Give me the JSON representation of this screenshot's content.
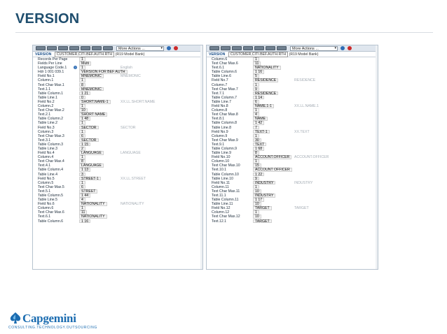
{
  "slide": {
    "title": "VERSION"
  },
  "toolbar": {
    "more_actions": "More Actions ..."
  },
  "left": {
    "app": "VERSION",
    "record_id": "CUSTOMER,CITI.BEF.AUTH.RTH",
    "model": "(R19 Model Bank)",
    "rows": [
      {
        "label": "Records Per Page",
        "value": "1",
        "hint": ""
      },
      {
        "label": "Fields Per Line",
        "value": "Multi",
        "hint": ""
      },
      {
        "label": "Language Code.1",
        "value": "1",
        "hint": "English",
        "help": true
      },
      {
        "label": "Hdr 1 001 039.1",
        "value": "VERSION FOR BEF AUTH",
        "hint": ""
      },
      {
        "label": "Field No.1",
        "value": "MNEMONIC",
        "hint": "MNEMONIC"
      },
      {
        "label": "Column.1",
        "value": "1",
        "hint": ""
      },
      {
        "label": "Text Char Max.1",
        "value": "8",
        "hint": ""
      },
      {
        "label": "Text.1.1",
        "value": "MNEMONIC",
        "hint": ""
      },
      {
        "label": "Table Column.1",
        "value": "1 21",
        "hint": ""
      },
      {
        "label": "Table Line.1",
        "value": "0",
        "hint": ""
      },
      {
        "label": "Field No.2",
        "value": "SHORT.NAME-1",
        "hint": "XX.LL.SHORT.NAME"
      },
      {
        "label": "Column.2",
        "value": "1",
        "hint": ""
      },
      {
        "label": "Text Char Max.2",
        "value": "10",
        "hint": ""
      },
      {
        "label": "Text.2.1",
        "value": "SHORT NAME",
        "hint": ""
      },
      {
        "label": "Table Column.2",
        "value": "1 48",
        "hint": ""
      },
      {
        "label": "Table Line.2",
        "value": "1",
        "hint": ""
      },
      {
        "label": "Field No.3",
        "value": "SECTOR",
        "hint": "SECTOR"
      },
      {
        "label": "Column.3",
        "value": "1",
        "hint": ""
      },
      {
        "label": "Text Char Max.3",
        "value": "6",
        "hint": ""
      },
      {
        "label": "Text.3.1",
        "value": "SECTOR",
        "hint": ""
      },
      {
        "label": "Table Column.3",
        "value": "1 15",
        "hint": ""
      },
      {
        "label": "Table Line.3",
        "value": "2",
        "hint": ""
      },
      {
        "label": "Field No.4",
        "value": "LANGUAGE",
        "hint": "LANGUAGE"
      },
      {
        "label": "Column.4",
        "value": "1",
        "hint": ""
      },
      {
        "label": "Text Char Max.4",
        "value": "8",
        "hint": ""
      },
      {
        "label": "Text.4.1",
        "value": "LANGUAGE",
        "hint": ""
      },
      {
        "label": "Table Column.4",
        "value": "1 13",
        "hint": ""
      },
      {
        "label": "Table Line.4",
        "value": "3",
        "hint": ""
      },
      {
        "label": "Field No.5",
        "value": "STREET-1",
        "hint": "XX.LL.STREET"
      },
      {
        "label": "Column.5",
        "value": "1",
        "hint": ""
      },
      {
        "label": "Text Char Max.5",
        "value": "6",
        "hint": ""
      },
      {
        "label": "Text.5.1",
        "value": "STREET",
        "hint": ""
      },
      {
        "label": "Table Column.5",
        "value": "1 44",
        "hint": ""
      },
      {
        "label": "Table Line.5",
        "value": "4",
        "hint": ""
      },
      {
        "label": "Field No.6",
        "value": "NATIONALITY",
        "hint": "NATIONALITY"
      },
      {
        "label": "Column.6",
        "value": "1",
        "hint": ""
      },
      {
        "label": "Text Char Max.6",
        "value": "11",
        "hint": ""
      },
      {
        "label": "Text.6.1",
        "value": "NATIONALITY",
        "hint": ""
      },
      {
        "label": "Table Column.6",
        "value": "1 16",
        "hint": ""
      }
    ]
  },
  "right": {
    "app": "VERSION",
    "record_id": "CUSTOMER,CITI.BEF.AUTH.RTH",
    "model": "(R19 Model Bank)",
    "rows": [
      {
        "label": "Column.6",
        "value": "1",
        "hint": ""
      },
      {
        "label": "Text Char Max.6",
        "value": "11",
        "hint": ""
      },
      {
        "label": "Text.6.1",
        "value": "NATIONALITY",
        "hint": ""
      },
      {
        "label": "Table Column.6",
        "value": "1 16",
        "hint": ""
      },
      {
        "label": "Table Line.6",
        "value": "5",
        "hint": ""
      },
      {
        "label": "Field No.7",
        "value": "RESIDENCE",
        "hint": "RESIDENCE"
      },
      {
        "label": "Column.7",
        "value": "1",
        "hint": ""
      },
      {
        "label": "Text Char Max.7",
        "value": "9",
        "hint": ""
      },
      {
        "label": "Text.7.1",
        "value": "RESIDENCE",
        "hint": ""
      },
      {
        "label": "Table Column.7",
        "value": "1 14",
        "hint": ""
      },
      {
        "label": "Table Line.7",
        "value": "6",
        "hint": ""
      },
      {
        "label": "Field No.8",
        "value": "NAME.1-1",
        "hint": "XX.LL.NAME.1"
      },
      {
        "label": "Column.8",
        "value": "1",
        "hint": ""
      },
      {
        "label": "Text Char Max.8",
        "value": "4",
        "hint": ""
      },
      {
        "label": "Text.8.1",
        "value": "NAME",
        "hint": ""
      },
      {
        "label": "Table Column.8",
        "value": "1 42",
        "hint": ""
      },
      {
        "label": "Table Line.8",
        "value": "7",
        "hint": ""
      },
      {
        "label": "Field No.9",
        "value": "TEXT-1",
        "hint": "XX.TEXT"
      },
      {
        "label": "Column.9",
        "value": "1",
        "hint": ""
      },
      {
        "label": "Text Char Max.9",
        "value": "30",
        "hint": ""
      },
      {
        "label": "Text.9.1",
        "value": "TEXT",
        "hint": ""
      },
      {
        "label": "Table Column.9",
        "value": "1 68",
        "hint": ""
      },
      {
        "label": "Table Line.9",
        "value": "8",
        "hint": ""
      },
      {
        "label": "Field No.10",
        "value": "ACCOUNT.OFFICER",
        "hint": "ACCOUNT.OFFICER"
      },
      {
        "label": "Column.10",
        "value": "1",
        "hint": ""
      },
      {
        "label": "Text Char Max.10",
        "value": "15",
        "hint": ""
      },
      {
        "label": "Text.10.1",
        "value": "ACCOUNT OFFICER",
        "hint": ""
      },
      {
        "label": "Table Column.10",
        "value": "1 22",
        "hint": ""
      },
      {
        "label": "Table Line.10",
        "value": "9",
        "hint": ""
      },
      {
        "label": "Field No.11",
        "value": "INDUSTRY",
        "hint": "INDUSTRY"
      },
      {
        "label": "Column.11",
        "value": "1",
        "hint": ""
      },
      {
        "label": "Text Char Max.11",
        "value": "10",
        "hint": ""
      },
      {
        "label": "Text.11.1",
        "value": "INDUSTRY",
        "hint": ""
      },
      {
        "label": "Table Column.11",
        "value": "1 17",
        "hint": ""
      },
      {
        "label": "Table Line.11",
        "value": "10",
        "hint": ""
      },
      {
        "label": "Field No.12",
        "value": "TARGET",
        "hint": "TARGET"
      },
      {
        "label": "Column.12",
        "value": "1",
        "hint": ""
      },
      {
        "label": "Text Char Max.12",
        "value": "10",
        "hint": ""
      },
      {
        "label": "Text.12.1",
        "value": "TARGET",
        "hint": ""
      }
    ]
  },
  "logo": {
    "name": "Capgemini",
    "tagline": "CONSULTING.TECHNOLOGY.OUTSOURCING"
  }
}
